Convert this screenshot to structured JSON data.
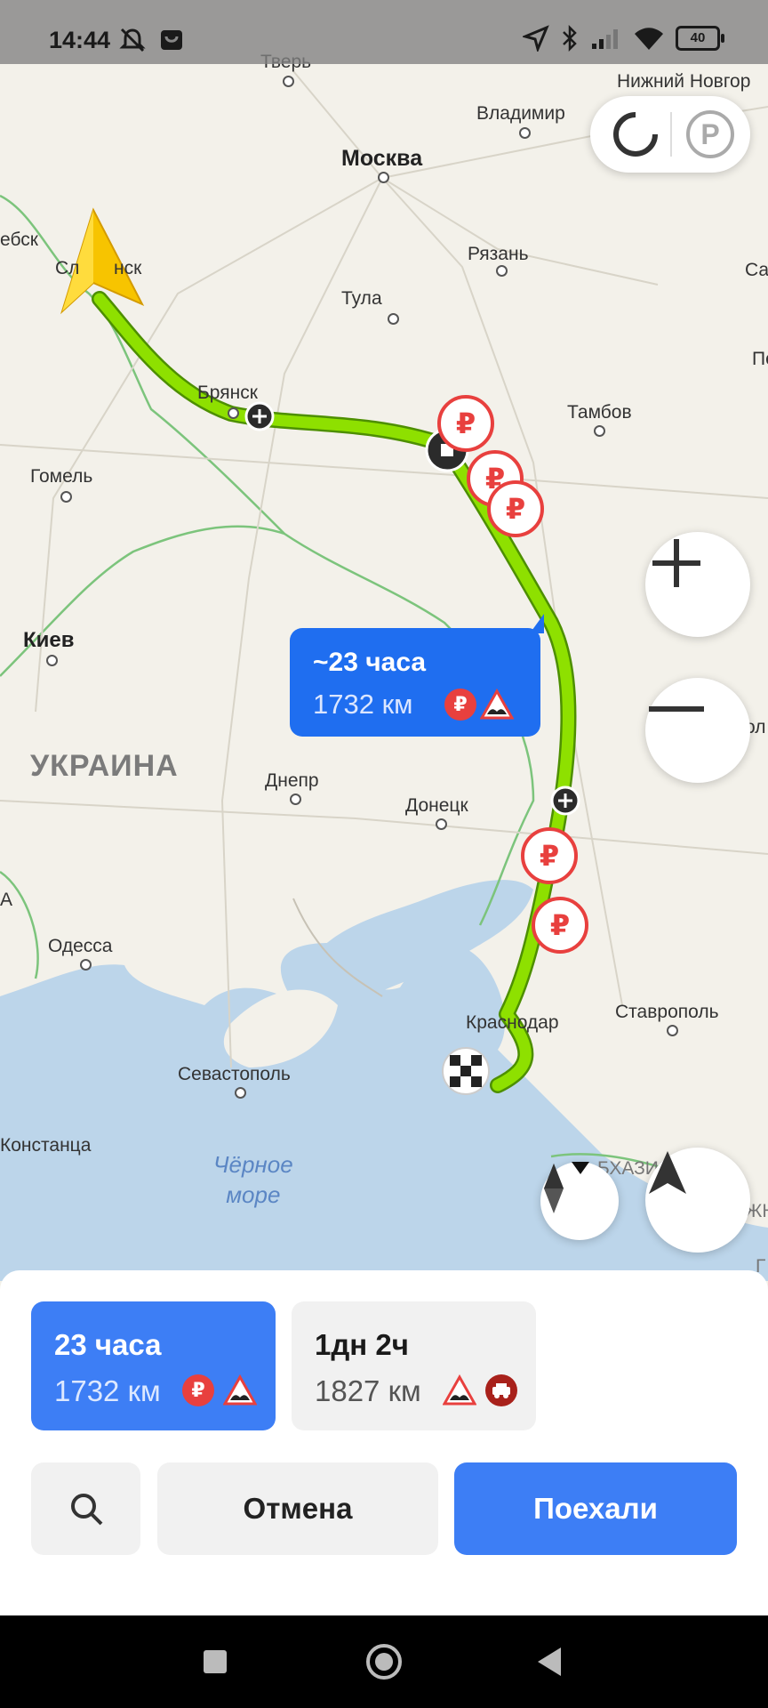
{
  "status_bar": {
    "time": "14:44",
    "battery": "40"
  },
  "map": {
    "cities": [
      {
        "name": "Тверь"
      },
      {
        "name": "Нижний Новгор"
      },
      {
        "name": "Владимир"
      },
      {
        "name": "Москва"
      },
      {
        "name": "ебск"
      },
      {
        "name": "Сл"
      },
      {
        "name": "нск"
      },
      {
        "name": "Рязань"
      },
      {
        "name": "Са"
      },
      {
        "name": "Тула"
      },
      {
        "name": "По"
      },
      {
        "name": "Брянск"
      },
      {
        "name": "Тамбов"
      },
      {
        "name": "Гомель"
      },
      {
        "name": "Киев"
      },
      {
        "name": "Вол"
      },
      {
        "name": "Днепр"
      },
      {
        "name": "Донецк"
      },
      {
        "name": "А"
      },
      {
        "name": "Одесса"
      },
      {
        "name": "Краснодар"
      },
      {
        "name": "Ставрополь"
      },
      {
        "name": "Севастополь"
      },
      {
        "name": "Констанца"
      },
      {
        "name": "БХАЗИЯ"
      },
      {
        "name": "ЖНАЯ"
      },
      {
        "name": "Г"
      }
    ],
    "country_label": "УКРАИНА",
    "sea_label_line1": "Чёрное",
    "sea_label_line2": "море",
    "route_bubble": {
      "time": "~23 часа",
      "distance": "1732 км"
    },
    "toll_symbol": "₽"
  },
  "route_options": [
    {
      "time": "23 часа",
      "distance": "1732 км",
      "selected": true
    },
    {
      "time": "1дн 2ч",
      "distance": "1827 км",
      "selected": false
    }
  ],
  "buttons": {
    "cancel": "Отмена",
    "go": "Поехали"
  },
  "colors": {
    "accent": "#3d7ef5",
    "route": "#8ee000",
    "toll": "#e8403e"
  }
}
